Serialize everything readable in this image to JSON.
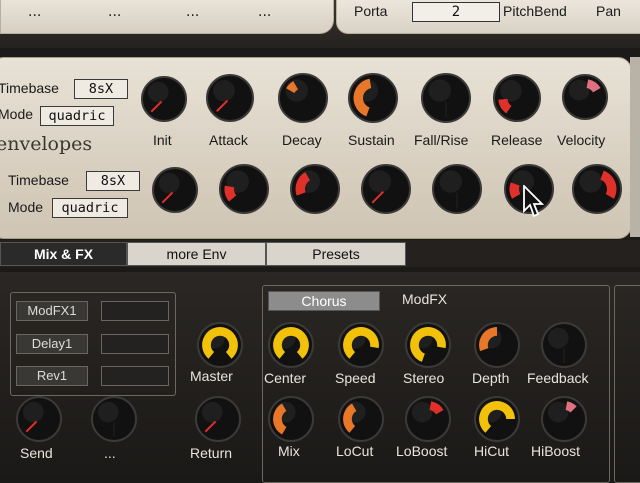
{
  "top": {
    "dots": [
      "...",
      "...",
      "...",
      "..."
    ],
    "porta_label": "Porta",
    "porta_value": "2",
    "pitchbend_label": "PitchBend",
    "pan_label": "Pan"
  },
  "envelopes": {
    "title": "envelopes",
    "row1": {
      "timebase_label": "Timebase",
      "timebase_value": "8sX",
      "mode_label": "Mode",
      "mode_value": "quadric"
    },
    "row2": {
      "timebase_label": "Timebase",
      "timebase_value": "8sX",
      "mode_label": "Mode",
      "mode_value": "quadric"
    },
    "knob_labels": [
      "Init",
      "Attack",
      "Decay",
      "Sustain",
      "Fall/Rise",
      "Release",
      "Velocity"
    ]
  },
  "tabs": [
    {
      "label": "Mix & FX",
      "active": true
    },
    {
      "label": "more Env",
      "active": false
    },
    {
      "label": "Presets",
      "active": false
    }
  ],
  "mixfx": {
    "slots": [
      "ModFX1",
      "Delay1",
      "Rev1"
    ],
    "send_label": "Send",
    "dots_label": "...",
    "master_label": "Master",
    "return_label": "Return",
    "chorus_button": "Chorus",
    "modfx_label": "ModFX",
    "fx_row1": [
      "Center",
      "Speed",
      "Stereo",
      "Depth",
      "Feedback"
    ],
    "fx_row2": [
      "Mix",
      "LoCut",
      "LoBoost",
      "HiCut",
      "HiBoost"
    ]
  },
  "colors": {
    "knob_red": "#e0302a",
    "knob_orange": "#e8772a",
    "knob_yellow": "#f2c20a",
    "knob_pink": "#e07080"
  }
}
